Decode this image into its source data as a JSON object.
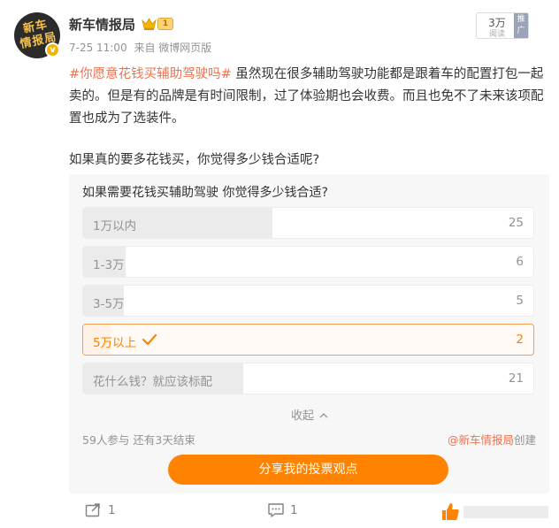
{
  "author": {
    "name": "新车情报局",
    "avatar_text": [
      "新车",
      "情报局"
    ],
    "member_badge": "1",
    "verify_mark": "v"
  },
  "meta": {
    "time": "7-25 11:00",
    "source": "来自 微博网页版"
  },
  "view_box": {
    "count": "3万",
    "label": "阅读",
    "promote": "推广"
  },
  "post": {
    "hashtag": "#你愿意花钱买辅助驾驶吗#",
    "text": " 虽然现在很多辅助驾驶功能都是跟着车的配置打包一起卖的。但是有的品牌是有时间限制，过了体验期也会收费。而且也免不了未来该项配置也成为了选装件。",
    "question": "如果真的要多花钱买，你觉得多少钱合适呢?"
  },
  "poll": {
    "title": "如果需要花钱买辅助驾驶 你觉得多少钱合适?",
    "options": [
      {
        "label": "1万以内",
        "count": "25",
        "fraction": 0.42
      },
      {
        "label": "1-3万",
        "count": "6",
        "fraction": 0.095
      },
      {
        "label": "3-5万",
        "count": "5",
        "fraction": 0.09
      },
      {
        "label": "5万以上",
        "count": "2",
        "fraction": 0.06,
        "selected": true
      },
      {
        "label": "花什么钱？就应该标配",
        "count": "21",
        "fraction": 0.355
      }
    ],
    "collapse_label": "收起",
    "participants": "59人参与  还有3天结束",
    "creator_handle": "@新车情报局",
    "creator_suffix": "创建",
    "share_label": "分享我的投票观点"
  },
  "actions": {
    "repost_count": "1",
    "comment_count": "1"
  },
  "colors": {
    "accent": "#ff8200",
    "hashtag": "#eb7350",
    "muted": "#939393"
  }
}
